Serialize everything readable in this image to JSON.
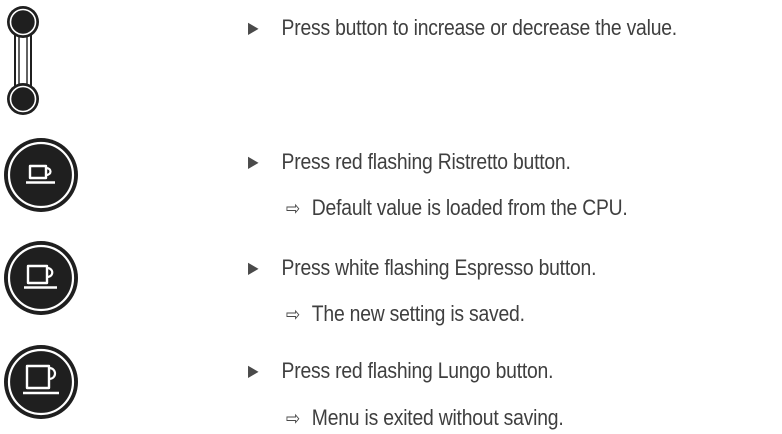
{
  "instructions": [
    {
      "icon": "up-down-buttons-icon",
      "step": "Press button to increase or decrease the value.",
      "result": ""
    },
    {
      "icon": "ristretto-button-icon",
      "step": "Press red flashing Ristretto button.",
      "result": "Default value is loaded from the CPU."
    },
    {
      "icon": "espresso-button-icon",
      "step": "Press white flashing Espresso button.",
      "result": "The new setting is saved."
    },
    {
      "icon": "lungo-button-icon",
      "step": "Press red flashing Lungo button.",
      "result": "Menu is exited without saving."
    }
  ],
  "symbols": {
    "step_marker": "▶",
    "result_marker": "⇨"
  },
  "colors": {
    "text": "#3f3f3f",
    "icon_fill": "#1f1f1f",
    "icon_line": "#ffffff"
  }
}
